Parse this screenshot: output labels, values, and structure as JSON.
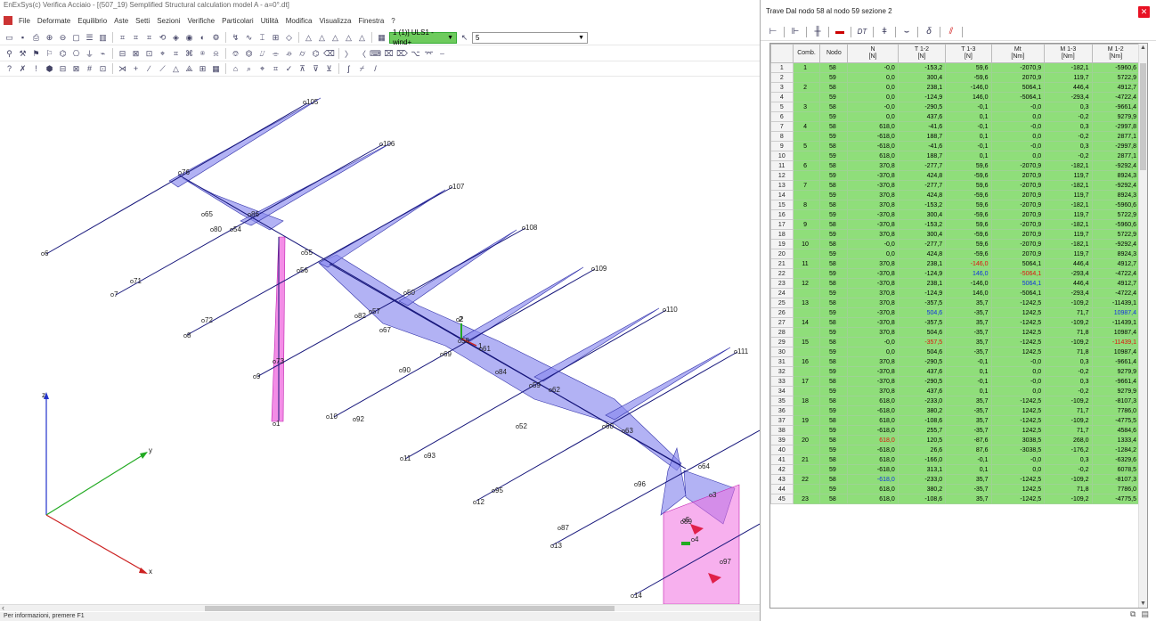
{
  "window": {
    "title": "EnExSys(c) Verifica Acciaio - [(507_19) Semplified Structural calculation model A - a=0°.dt]"
  },
  "menu": [
    "File",
    "Deformate",
    "Equilibrio",
    "Aste",
    "Setti",
    "Sezioni",
    "Verifiche",
    "Particolari",
    "Utilità",
    "Modifica",
    "Visualizza",
    "Finestra",
    "?"
  ],
  "toolbar": {
    "combo_case": "1 (1)] ULS1 - wind+",
    "combo_value": "5"
  },
  "viewport": {
    "node_labels": [
      "105",
      "106",
      "107",
      "108",
      "109",
      "110",
      "111",
      "6",
      "7",
      "8",
      "9",
      "10",
      "11",
      "12",
      "13",
      "14",
      "1",
      "2",
      "3",
      "4",
      "5",
      "50",
      "52",
      "54",
      "55",
      "56",
      "57",
      "58",
      "59",
      "60",
      "61",
      "62",
      "63",
      "64",
      "65",
      "67",
      "69",
      "71",
      "72",
      "73",
      "76",
      "80",
      "82",
      "84",
      "86",
      "87",
      "89",
      "90",
      "92",
      "93",
      "95",
      "96",
      "97"
    ],
    "axes": {
      "x": "x",
      "y": "y",
      "z": "z"
    },
    "colors": {
      "beam": "#0a0a7a",
      "diagram_fill": "#8888ee",
      "pink_fill": "#f060e0"
    }
  },
  "status": {
    "text": "Per informazioni, premere F1"
  },
  "panel": {
    "title": "Trave Dal nodo 58 al nodo 59  sezione 2",
    "close_icon": "close-icon",
    "tools": [
      "beam-icon",
      "node-icon",
      "section-icon",
      "flag-icon",
      "DT",
      "temperature-icon",
      "curve-icon",
      "δ",
      "chart-icon"
    ],
    "columns": [
      {
        "label": "",
        "unit": ""
      },
      {
        "label": "Comb.",
        "unit": ""
      },
      {
        "label": "Nodo",
        "unit": ""
      },
      {
        "label": "N",
        "unit": "[N]"
      },
      {
        "label": "T 1-2",
        "unit": "[N]"
      },
      {
        "label": "T 1-3",
        "unit": "[N]"
      },
      {
        "label": "Mt",
        "unit": "[Nm]"
      },
      {
        "label": "M 1-3",
        "unit": "[Nm]"
      },
      {
        "label": "M 1-2",
        "unit": "[Nm]"
      }
    ],
    "rows": [
      [
        "1",
        "1",
        "58",
        "-0,0",
        "-153,2",
        "59,6",
        "-2070,9",
        "-182,1",
        "-5960,6"
      ],
      [
        "2",
        "",
        "59",
        "0,0",
        "300,4",
        "-59,6",
        "2070,9",
        "119,7",
        "5722,9"
      ],
      [
        "3",
        "2",
        "58",
        "0,0",
        "238,1",
        "-146,0",
        "5064,1",
        "446,4",
        "4912,7"
      ],
      [
        "4",
        "",
        "59",
        "0,0",
        "-124,9",
        "146,0",
        "-5064,1",
        "-293,4",
        "-4722,4"
      ],
      [
        "5",
        "3",
        "58",
        "-0,0",
        "-290,5",
        "-0,1",
        "-0,0",
        "0,3",
        "-9661,4"
      ],
      [
        "6",
        "",
        "59",
        "0,0",
        "437,6",
        "0,1",
        "0,0",
        "-0,2",
        "9279,9"
      ],
      [
        "7",
        "4",
        "58",
        "618,0",
        "-41,6",
        "-0,1",
        "-0,0",
        "0,3",
        "-2997,8"
      ],
      [
        "8",
        "",
        "59",
        "-618,0",
        "188,7",
        "0,1",
        "0,0",
        "-0,2",
        "2877,1"
      ],
      [
        "9",
        "5",
        "58",
        "-618,0",
        "-41,6",
        "-0,1",
        "-0,0",
        "0,3",
        "-2997,8"
      ],
      [
        "10",
        "",
        "59",
        "618,0",
        "188,7",
        "0,1",
        "0,0",
        "-0,2",
        "2877,1"
      ],
      [
        "11",
        "6",
        "58",
        "370,8",
        "-277,7",
        "59,6",
        "-2070,9",
        "-182,1",
        "-9292,4"
      ],
      [
        "12",
        "",
        "59",
        "-370,8",
        "424,8",
        "-59,6",
        "2070,9",
        "119,7",
        "8924,3"
      ],
      [
        "13",
        "7",
        "58",
        "-370,8",
        "-277,7",
        "59,6",
        "-2070,9",
        "-182,1",
        "-9292,4"
      ],
      [
        "14",
        "",
        "59",
        "370,8",
        "424,8",
        "-59,6",
        "2070,9",
        "119,7",
        "8924,3"
      ],
      [
        "15",
        "8",
        "58",
        "370,8",
        "-153,2",
        "59,6",
        "-2070,9",
        "-182,1",
        "-5960,6"
      ],
      [
        "16",
        "",
        "59",
        "-370,8",
        "300,4",
        "-59,6",
        "2070,9",
        "119,7",
        "5722,9"
      ],
      [
        "17",
        "9",
        "58",
        "-370,8",
        "-153,2",
        "59,6",
        "-2070,9",
        "-182,1",
        "-5960,6"
      ],
      [
        "18",
        "",
        "59",
        "370,8",
        "300,4",
        "-59,6",
        "2070,9",
        "119,7",
        "5722,9"
      ],
      [
        "19",
        "10",
        "58",
        "-0,0",
        "-277,7",
        "59,6",
        "-2070,9",
        "-182,1",
        "-9292,4"
      ],
      [
        "20",
        "",
        "59",
        "0,0",
        "424,8",
        "-59,6",
        "2070,9",
        "119,7",
        "8924,3"
      ],
      [
        "21",
        "11",
        "58",
        "370,8",
        "238,1",
        "-146,0",
        "5064,1",
        "446,4",
        "4912,7"
      ],
      [
        "22",
        "",
        "59",
        "-370,8",
        "-124,9",
        "146,0",
        "-5064,1",
        "-293,4",
        "-4722,4"
      ],
      [
        "23",
        "12",
        "58",
        "-370,8",
        "238,1",
        "-146,0",
        "5064,1",
        "446,4",
        "4912,7"
      ],
      [
        "24",
        "",
        "59",
        "370,8",
        "-124,9",
        "146,0",
        "-5064,1",
        "-293,4",
        "-4722,4"
      ],
      [
        "25",
        "13",
        "58",
        "370,8",
        "-357,5",
        "35,7",
        "-1242,5",
        "-109,2",
        "-11439,1"
      ],
      [
        "26",
        "",
        "59",
        "-370,8",
        "504,6",
        "-35,7",
        "1242,5",
        "71,7",
        "10987,4"
      ],
      [
        "27",
        "14",
        "58",
        "-370,8",
        "-357,5",
        "35,7",
        "-1242,5",
        "-109,2",
        "-11439,1"
      ],
      [
        "28",
        "",
        "59",
        "370,8",
        "504,6",
        "-35,7",
        "1242,5",
        "71,8",
        "10987,4"
      ],
      [
        "29",
        "15",
        "58",
        "-0,0",
        "-357,5",
        "35,7",
        "-1242,5",
        "-109,2",
        "-11439,1"
      ],
      [
        "30",
        "",
        "59",
        "0,0",
        "504,6",
        "-35,7",
        "1242,5",
        "71,8",
        "10987,4"
      ],
      [
        "31",
        "16",
        "58",
        "370,8",
        "-290,5",
        "-0,1",
        "-0,0",
        "0,3",
        "-9661,4"
      ],
      [
        "32",
        "",
        "59",
        "-370,8",
        "437,6",
        "0,1",
        "0,0",
        "-0,2",
        "9279,9"
      ],
      [
        "33",
        "17",
        "58",
        "-370,8",
        "-290,5",
        "-0,1",
        "-0,0",
        "0,3",
        "-9661,4"
      ],
      [
        "34",
        "",
        "59",
        "370,8",
        "437,6",
        "0,1",
        "0,0",
        "-0,2",
        "9279,9"
      ],
      [
        "35",
        "18",
        "58",
        "618,0",
        "-233,0",
        "35,7",
        "-1242,5",
        "-109,2",
        "-8107,3"
      ],
      [
        "36",
        "",
        "59",
        "-618,0",
        "380,2",
        "-35,7",
        "1242,5",
        "71,7",
        "7786,0"
      ],
      [
        "37",
        "19",
        "58",
        "618,0",
        "-108,6",
        "35,7",
        "-1242,5",
        "-109,2",
        "-4775,5"
      ],
      [
        "38",
        "",
        "59",
        "-618,0",
        "255,7",
        "-35,7",
        "1242,5",
        "71,7",
        "4584,6"
      ],
      [
        "39",
        "20",
        "58",
        "618,0",
        "120,5",
        "-87,6",
        "3038,5",
        "268,0",
        "1333,4"
      ],
      [
        "40",
        "",
        "59",
        "-618,0",
        "26,6",
        "87,6",
        "-3038,5",
        "-176,2",
        "-1284,2"
      ],
      [
        "41",
        "21",
        "58",
        "618,0",
        "-166,0",
        "-0,1",
        "-0,0",
        "0,3",
        "-6329,6"
      ],
      [
        "42",
        "",
        "59",
        "-618,0",
        "313,1",
        "0,1",
        "0,0",
        "-0,2",
        "6078,5"
      ],
      [
        "43",
        "22",
        "58",
        "-618,0",
        "-233,0",
        "35,7",
        "-1242,5",
        "-109,2",
        "-8107,3"
      ],
      [
        "44",
        "",
        "59",
        "618,0",
        "380,2",
        "-35,7",
        "1242,5",
        "71,8",
        "7786,0"
      ],
      [
        "45",
        "23",
        "58",
        "618,0",
        "-108,6",
        "35,7",
        "-1242,5",
        "-109,2",
        "-4775,5"
      ]
    ],
    "highlights": {
      "red": [
        [
          20,
          5
        ],
        [
          21,
          6
        ],
        [
          28,
          4
        ],
        [
          28,
          8
        ],
        [
          38,
          3
        ]
      ],
      "blue": [
        [
          21,
          5
        ],
        [
          22,
          6
        ],
        [
          25,
          4
        ],
        [
          25,
          8
        ],
        [
          42,
          3
        ]
      ]
    }
  }
}
